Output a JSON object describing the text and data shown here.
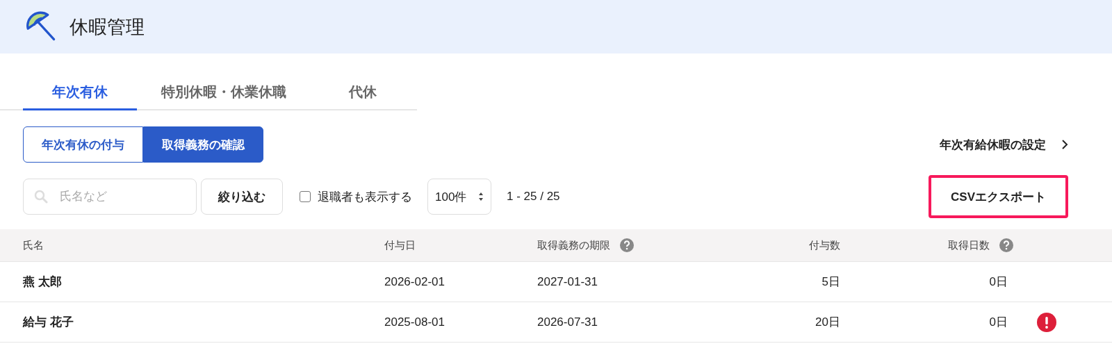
{
  "app": {
    "title": "休暇管理"
  },
  "tabs": [
    {
      "label": "年次有休",
      "selected": true
    },
    {
      "label": "特別休暇・休業休職",
      "selected": false
    },
    {
      "label": "代休",
      "selected": false
    }
  ],
  "segments": [
    {
      "label": "年次有休の付与",
      "selected": false
    },
    {
      "label": "取得義務の確認",
      "selected": true
    }
  ],
  "settings_link": {
    "label": "年次有給休暇の設定"
  },
  "search": {
    "placeholder": "氏名など"
  },
  "filter_button": {
    "label": "絞り込む"
  },
  "show_retired": {
    "label": "退職者も表示する",
    "checked": false
  },
  "page_size": {
    "value": "100件"
  },
  "range": "1 - 25 / 25",
  "export_button": {
    "label": "CSVエクスポート",
    "highlighted": true
  },
  "table": {
    "columns": [
      {
        "label": "氏名",
        "help": false
      },
      {
        "label": "付与日",
        "help": false
      },
      {
        "label": "取得義務の期限",
        "help": true
      },
      {
        "label": "付与数",
        "help": false
      },
      {
        "label": "取得日数",
        "help": true
      }
    ],
    "rows": [
      {
        "cells": [
          "燕 太郎",
          "2026-02-01",
          "2027-01-31",
          "5日",
          "0日"
        ],
        "alert": false
      },
      {
        "cells": [
          "給与 花子",
          "2025-08-01",
          "2026-07-31",
          "20日",
          "0日"
        ],
        "alert": true
      }
    ]
  }
}
